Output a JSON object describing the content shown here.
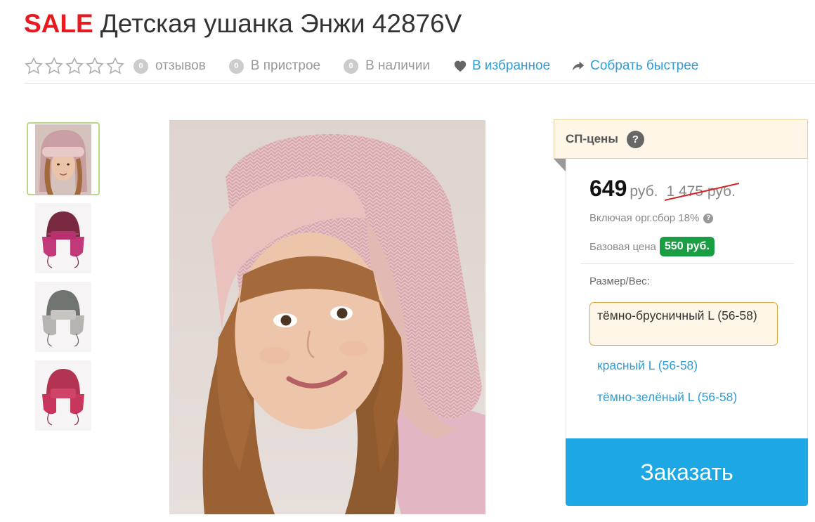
{
  "product": {
    "sale_tag": "SALE",
    "title": "Детская ушанка Энжи 42876V"
  },
  "meta": {
    "reviews": {
      "count": "0",
      "label": "отзывов"
    },
    "attached": {
      "count": "0",
      "label": "В пристрое"
    },
    "in_stock": {
      "count": "0",
      "label": "В наличии"
    },
    "favorite": {
      "label": "В избранное",
      "icon": "heart-icon"
    },
    "collect": {
      "label": "Собрать быстрее",
      "icon": "share-arrow-icon"
    },
    "rating": 0,
    "rating_max": 5,
    "link_color": "#2f9dd6"
  },
  "gallery": {
    "thumbnails": [
      {
        "description": "girl in pink ushanka"
      },
      {
        "description": "dark-cranberry hat"
      },
      {
        "description": "grey hat"
      },
      {
        "description": "red hat"
      }
    ],
    "selected": 0
  },
  "pricing": {
    "header": "СП-цены",
    "help": "?",
    "price": "649",
    "currency": "руб.",
    "old_price": "1 475 руб.",
    "fee_note": "Включая орг.сбор 18%",
    "fee_help": "?",
    "base_label": "Базовая цена",
    "base_price": "550 руб."
  },
  "sizes": {
    "label": "Размер/Вес:",
    "selected": "тёмно-брусничный L (56-58)",
    "options": [
      "красный L (56-58)",
      "тёмно-зелёный L (56-58)"
    ]
  },
  "order_button": "Заказать",
  "colors": {
    "sale": "#e8191f",
    "accent_blue": "#1da7e4",
    "base_badge": "#1a9e44"
  }
}
